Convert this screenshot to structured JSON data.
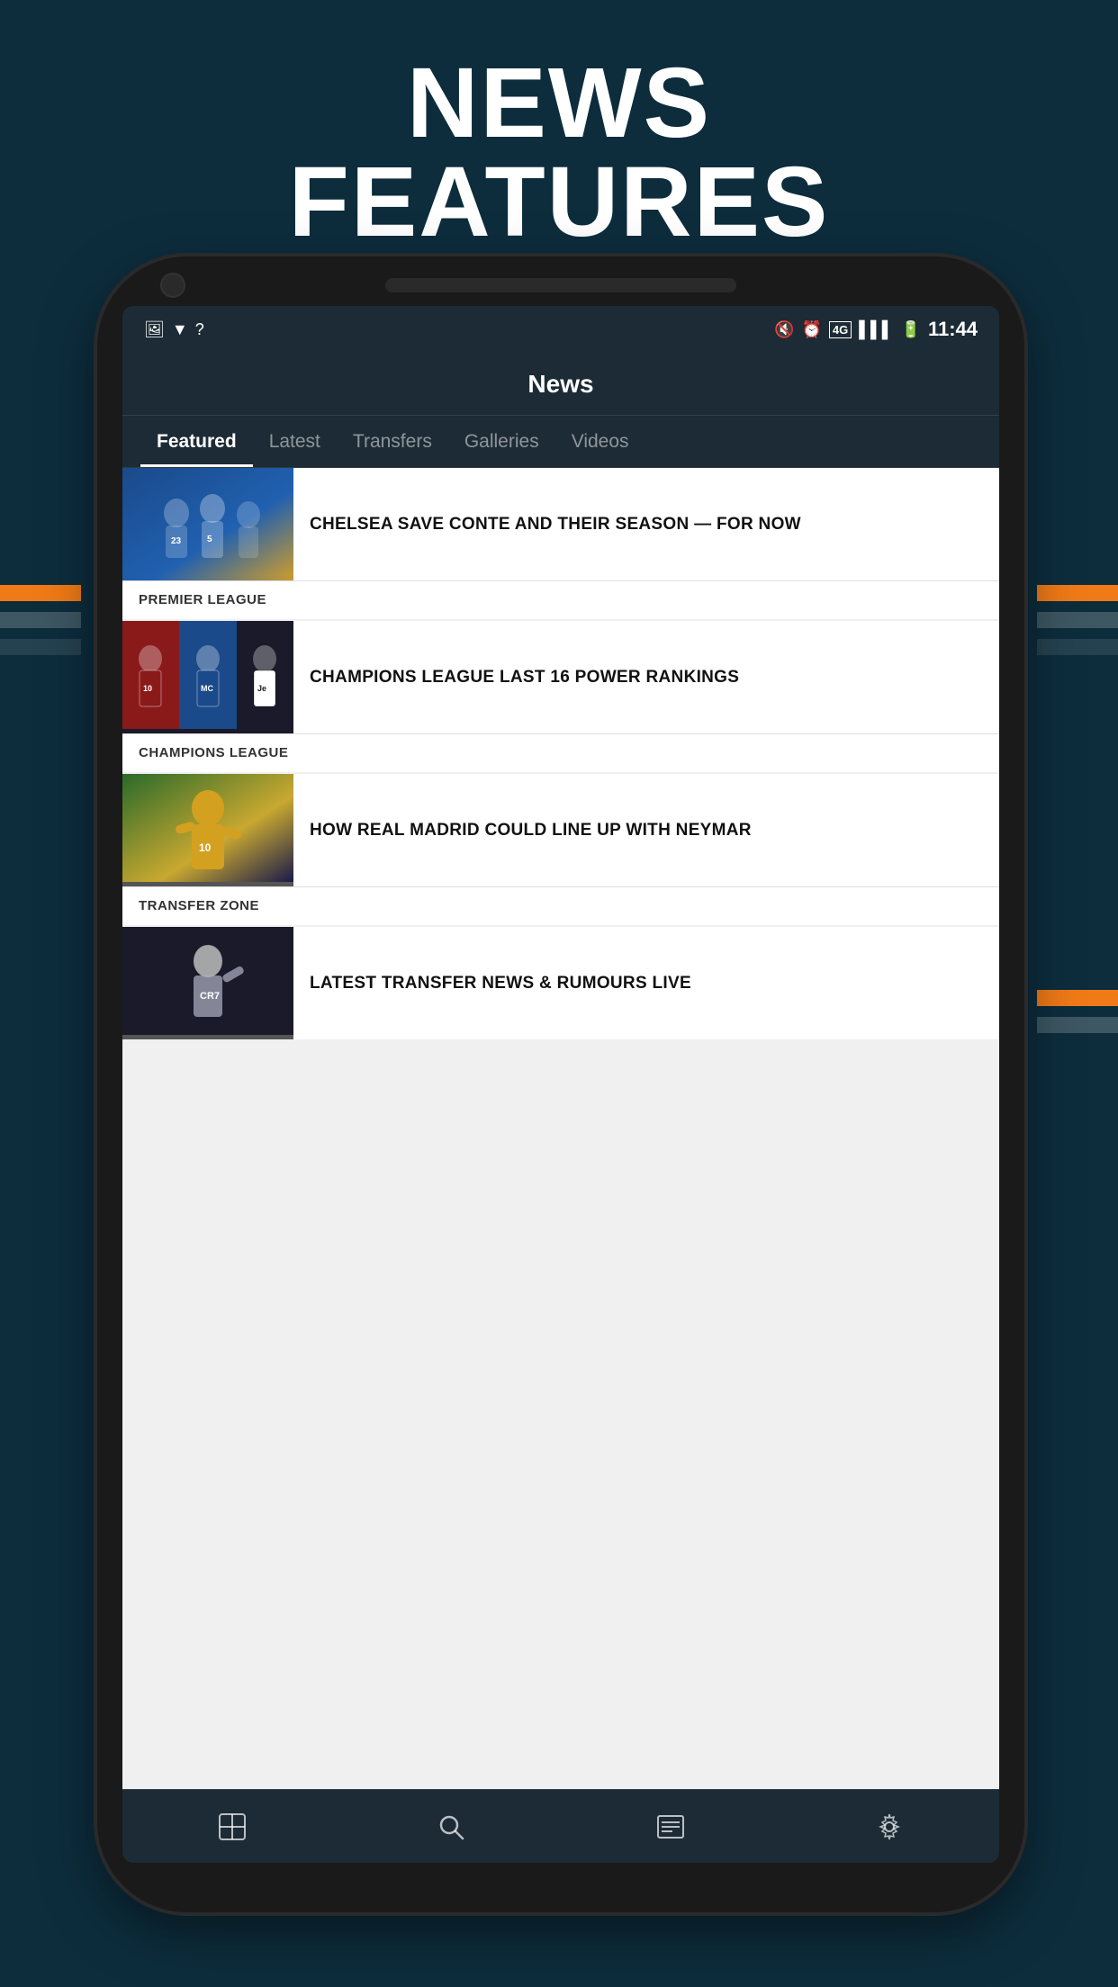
{
  "page": {
    "title_line1": "NEWS",
    "title_line2": "FEATURES",
    "bg_color": "#0d2d3d",
    "accent_color": "#f07a17"
  },
  "status_bar": {
    "time": "11:44"
  },
  "header": {
    "title": "News"
  },
  "tabs": [
    {
      "label": "Featured",
      "active": true
    },
    {
      "label": "Latest",
      "active": false
    },
    {
      "label": "Transfers",
      "active": false
    },
    {
      "label": "Galleries",
      "active": false
    },
    {
      "label": "Videos",
      "active": false
    }
  ],
  "news_items": [
    {
      "title": "CHELSEA SAVE CONTE AND THEIR SEASON — FOR NOW",
      "category": "PREMIER LEAGUE",
      "thumb_class": "thumb-1"
    },
    {
      "title": "CHAMPIONS LEAGUE LAST 16 POWER RANKINGS",
      "category": "CHAMPIONS LEAGUE",
      "thumb_class": "thumb-2"
    },
    {
      "title": "HOW REAL MADRID COULD LINE UP WITH NEYMAR",
      "category": "TRANSFER ZONE",
      "thumb_class": "thumb-3"
    },
    {
      "title": "LATEST TRANSFER NEWS & RUMOURS LIVE",
      "category": "",
      "thumb_class": "thumb-4"
    }
  ],
  "bottom_nav": [
    {
      "icon": "⊞",
      "label": "scores",
      "active": false
    },
    {
      "icon": "⌕",
      "label": "search",
      "active": false
    },
    {
      "icon": "☰",
      "label": "news",
      "active": false
    },
    {
      "icon": "⚙",
      "label": "settings",
      "active": false
    }
  ]
}
